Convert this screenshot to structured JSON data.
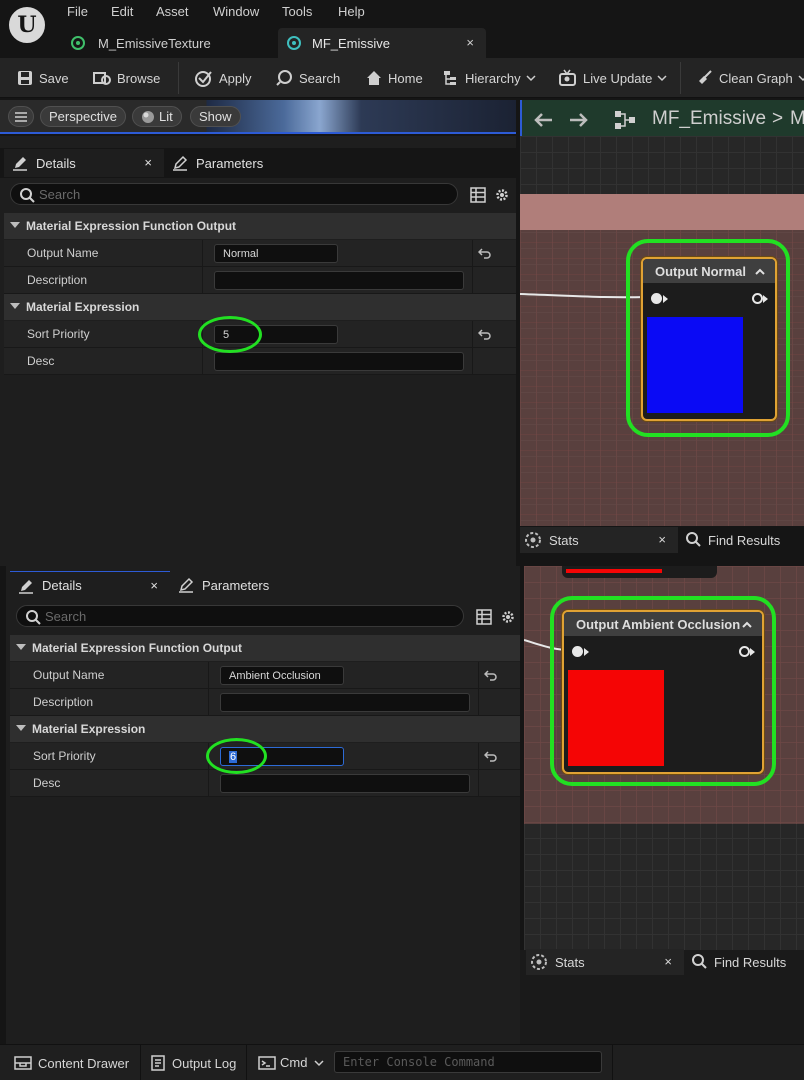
{
  "app": {
    "logo_letter": "U"
  },
  "menu": [
    "File",
    "Edit",
    "Asset",
    "Window",
    "Tools",
    "Help"
  ],
  "doc_tabs": [
    {
      "label": "M_EmissiveTexture",
      "active": false
    },
    {
      "label": "MF_Emissive",
      "active": true,
      "close": "×"
    }
  ],
  "toolbar": {
    "save": "Save",
    "browse": "Browse",
    "apply": "Apply",
    "search": "Search",
    "home": "Home",
    "hierarchy": "Hierarchy",
    "live_update": "Live Update",
    "clean_graph": "Clean Graph"
  },
  "viewport": {
    "perspective": "Perspective",
    "lit": "Lit",
    "show": "Show"
  },
  "graph_header": {
    "title": "MF_Emissive",
    "sep": ">",
    "trail": "M"
  },
  "top_panel": {
    "details_tab": "Details",
    "params_tab": "Parameters",
    "close": "×",
    "search_placeholder": "Search",
    "cat1": "Material Expression Function Output",
    "output_name_label": "Output Name",
    "output_name_value": "Normal",
    "description_label": "Description",
    "description_value": "",
    "cat2": "Material Expression",
    "sort_label": "Sort Priority",
    "sort_value": "5",
    "desc_label": "Desc",
    "desc_value": ""
  },
  "bottom_panel": {
    "details_tab": "Details",
    "params_tab": "Parameters",
    "close": "×",
    "search_placeholder": "Search",
    "cat1": "Material Expression Function Output",
    "output_name_label": "Output Name",
    "output_name_value": "Ambient Occlusion",
    "description_label": "Description",
    "description_value": "",
    "cat2": "Material Expression",
    "sort_label": "Sort Priority",
    "sort_value": "6",
    "desc_label": "Desc",
    "desc_value": ""
  },
  "node_top": {
    "title": "Output Normal",
    "swatch_color": "#0a0af5"
  },
  "node_bottom": {
    "title": "Output Ambient Occlusion",
    "swatch_color": "#f50505"
  },
  "stats_tabs_top": {
    "stats": "Stats",
    "close": "×",
    "find": "Find Results"
  },
  "stats_tabs_bottom": {
    "stats": "Stats",
    "close": "×",
    "find": "Find Results"
  },
  "statusbar": {
    "content_drawer": "Content Drawer",
    "output_log": "Output Log",
    "cmd": "Cmd",
    "console_placeholder": "Enter Console Command"
  },
  "colors": {
    "highlight": "#22e022",
    "node_border": "#e0a234",
    "accent": "#2d5bd6"
  }
}
